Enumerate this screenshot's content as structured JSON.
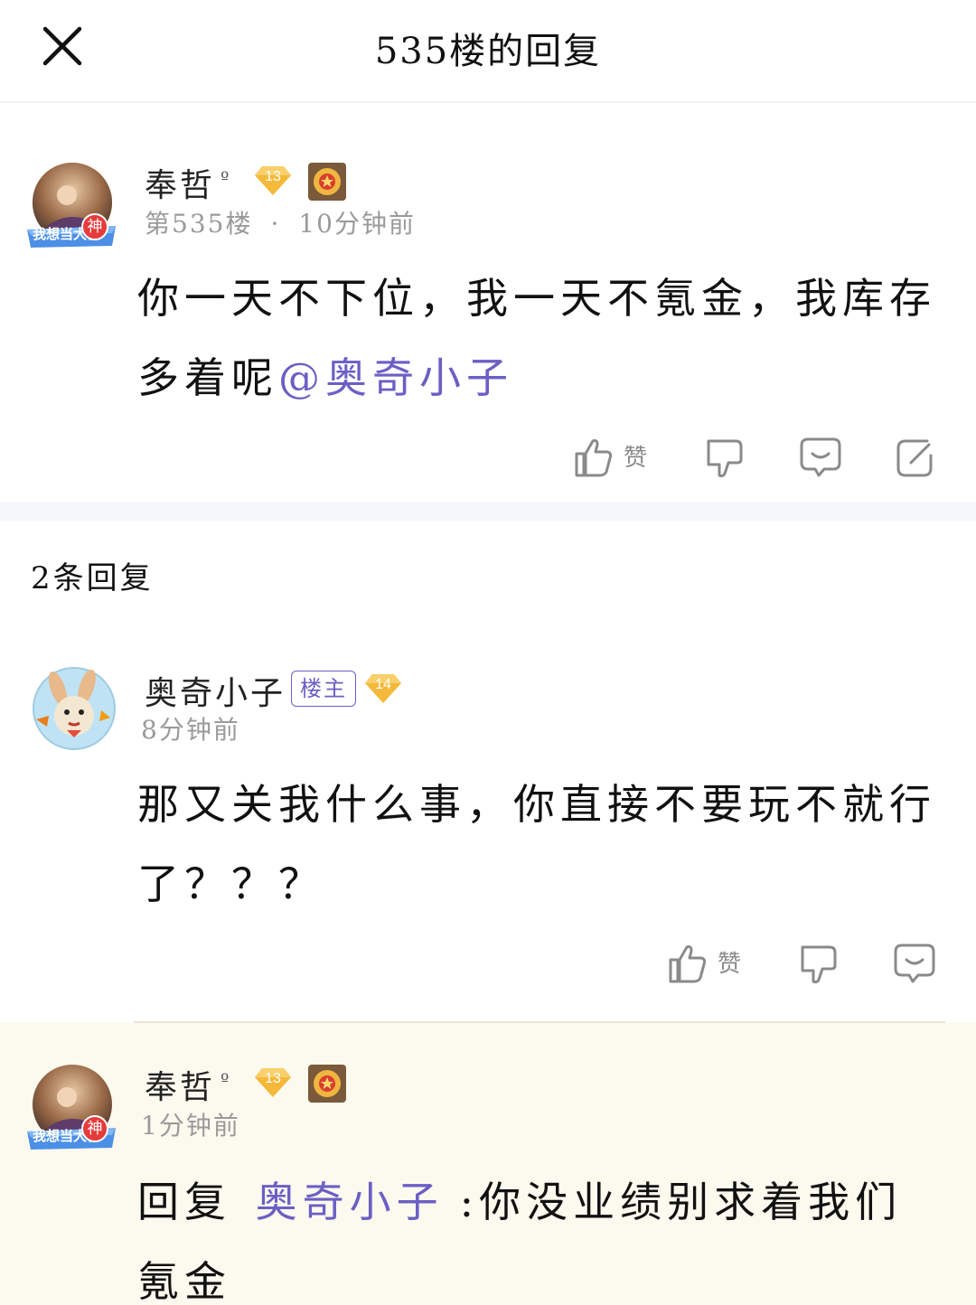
{
  "header": {
    "title": "535楼的回复",
    "close_icon": "close-icon"
  },
  "main_post": {
    "username": "奉哲",
    "gender_mark": "º",
    "level": "13",
    "floor": "第535楼",
    "separator": "·",
    "time": "10分钟前",
    "text": "你一天不下位，我一天不氪金，我库存多着呢",
    "mention": "@奥奇小子",
    "avatar_frame_text": "我想当大神",
    "avatar_badge": "神",
    "like_label": "赞"
  },
  "reply_count": "2条回复",
  "replies": [
    {
      "username": "奥奇小子",
      "tag": "楼主",
      "level": "14",
      "time": "8分钟前",
      "text": "那又关我什么事，你直接不要玩不就行了？？？",
      "like_label": "赞"
    },
    {
      "username": "奉哲",
      "gender_mark": "º",
      "level": "13",
      "time": "1分钟前",
      "reply_prefix": "回复",
      "reply_target": "奥奇小子",
      "text": ":你没业绩别求着我们氪金",
      "avatar_frame_text": "我想当大神",
      "avatar_badge": "神"
    }
  ],
  "colors": {
    "accent": "#6b5fc4",
    "level_gold": "#f4b93a",
    "highlight_bg": "#fcf9ee"
  }
}
